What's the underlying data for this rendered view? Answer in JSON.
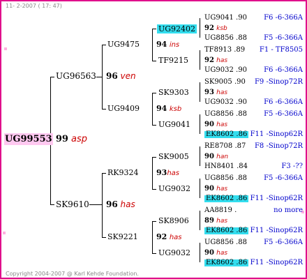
{
  "header": {
    "date_text": "11-  2-2007  ( 17: 47)"
  },
  "footer": {
    "copyright": "Copyright 2004-2007 @ Karl Kehde Foundation."
  },
  "root": {
    "id": "UG99553",
    "num": "99",
    "sp": "asp"
  },
  "sire": {
    "id": "UG96563",
    "num": "96",
    "sp": "ven"
  },
  "dam": {
    "id": "SK9610",
    "num": "96",
    "sp": "has"
  },
  "g3": [
    {
      "id": "UG9475",
      "num": "94",
      "sp": "ins"
    },
    {
      "id": "UG9409",
      "num": "94",
      "sp": "ksb"
    },
    {
      "id": "RK9324",
      "num": "93",
      "sp": "has"
    },
    {
      "id": "SK9221",
      "num": "92",
      "sp": "has"
    }
  ],
  "g4": [
    "UG92402",
    "TF9215",
    "SK9303",
    "UG9041",
    "SK9005",
    "UG9032",
    "SK8906",
    "UG9032"
  ],
  "g5": [
    {
      "top": "UG9041 .90",
      "num": "92",
      "sp": "ksb",
      "bot": "UG8856 .88",
      "rt": "F6 -6-366A",
      "rb": "F5 -6-366A"
    },
    {
      "top": "TF8913 .89",
      "num": "92",
      "sp": "has",
      "bot": "UG9032 .90",
      "rt": "F1 - TF8505",
      "rb": "F6 -6-366A"
    },
    {
      "top": "SK9005 .90",
      "num": "93",
      "sp": "has",
      "bot": "UG9032 .90",
      "rt": "F9 -Sinop72R",
      "rb": "F6 -6-366A"
    },
    {
      "top": "UG8856 .88",
      "num": "90",
      "sp": "has",
      "bot": "EK8602 .86",
      "rt": "F5 -6-366A",
      "rb": "F11 -Sinop62R"
    },
    {
      "top": "RE8708 .87",
      "num": "90",
      "sp": "han",
      "bot": "HN8401 .84",
      "rt": "F8 -Sinop72R",
      "rb": "F3 -??"
    },
    {
      "top": "UG8856 .88",
      "num": "90",
      "sp": "has",
      "bot": "EK8602 .86",
      "rt": "F5 -6-366A",
      "rb": "F11 -Sinop62R"
    },
    {
      "top": "AA8819 .",
      "num": "89",
      "sp": "has",
      "bot": "EK8602 .86",
      "rt": "no more",
      "rb": "F11 -Sinop62R"
    },
    {
      "top": "UG8856 .88",
      "num": "90",
      "sp": "has",
      "bot": "EK8602 .86",
      "rt": "F5 -6-366A",
      "rb": "F11 -Sinop62R"
    }
  ]
}
